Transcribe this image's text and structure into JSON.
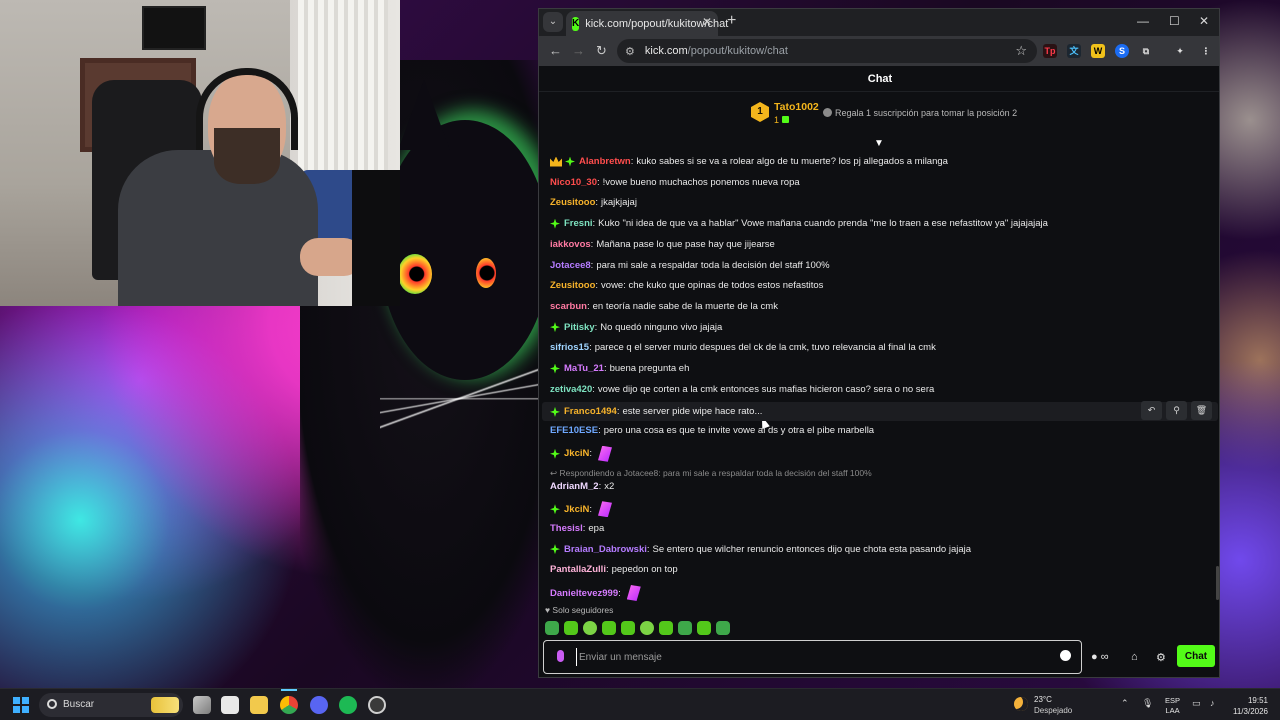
{
  "browser": {
    "tab_title": "kick.com/popout/kukitow/chat",
    "url_host": "kick.com",
    "url_path": "/popout/kukitow/chat"
  },
  "chat": {
    "header_title": "Chat",
    "leaderboard": {
      "rank": "1",
      "name": "Tato1002",
      "count": "1",
      "hint": "Regala 1 suscripción para tomar la posición 2"
    },
    "messages": [
      {
        "user": "Alanbretwn",
        "text": "kuko sabes si se va a rolear algo de tu muerte? los pj allegados a milanga",
        "color": "#ff4d4d",
        "badges": [
          "crown",
          "sub"
        ]
      },
      {
        "user": "Nico10_30",
        "text": "!vowe bueno muchachos ponemos nueva ropa",
        "color": "#ff4d4d",
        "badges": []
      },
      {
        "user": "Zeusitooo",
        "text": "jkajkjajaj",
        "color": "#f7b32b",
        "badges": []
      },
      {
        "user": "Fresni",
        "text": "Kuko \"ni idea de que va a hablar\" Vowe mañana cuando prenda \"me lo traen a ese nefastitow ya\" jajajajaja",
        "color": "#7ee3c1",
        "badges": [
          "sub"
        ]
      },
      {
        "user": "iakkovos",
        "text": "Mañana pase lo que pase hay que jijearse",
        "color": "#ff7aa2",
        "badges": []
      },
      {
        "user": "Jotacee8",
        "text": "para mi sale a respaldar toda la decisión del staff 100%",
        "color": "#b57cff",
        "badges": []
      },
      {
        "user": "Zeusitooo",
        "text": "vowe: che kuko que opinas de todos estos nefastitos",
        "color": "#f7b32b",
        "badges": []
      },
      {
        "user": "scarbun",
        "text": "en teoría nadie sabe de la muerte de la cmk",
        "color": "#ff7aa2",
        "badges": []
      },
      {
        "user": "Pitisky",
        "text": "No quedó ninguno vivo jajaja",
        "color": "#7ee3c1",
        "badges": [
          "sub"
        ]
      },
      {
        "user": "sifrios15",
        "text": "parece q el server murio despues del ck de la cmk, tuvo relevancia al final la cmk",
        "color": "#9fd4ff",
        "badges": []
      },
      {
        "user": "MaTu_21",
        "text": "buena pregunta eh",
        "color": "#d67bff",
        "badges": [
          "sub"
        ]
      },
      {
        "user": "zetiva420",
        "text": "vowe dijo qe corten a la cmk entonces sus mafias hicieron caso? sera o no sera",
        "color": "#7ee3c1",
        "badges": []
      },
      {
        "user": "Franco1494",
        "text": "este server pide wipe hace rato...",
        "color": "#f7b32b",
        "badges": [
          "sub"
        ],
        "highlighted": true
      },
      {
        "user": "EFE10ESE",
        "text": "pero una cosa es que te invite vowe al ds y otra el pibe marbella",
        "color": "#6fa8ff",
        "badges": []
      },
      {
        "user": "JkciN",
        "text": "",
        "color": "#f7b32b",
        "badges": [
          "sub"
        ],
        "emote": true
      },
      {
        "user": "AdrianM_2",
        "text": "x2",
        "color": "#f0d9ff",
        "badges": [],
        "reply": "Respondiendo a Jotacee8: para mi sale a respaldar toda la decisión del staff 100%"
      },
      {
        "user": "JkciN",
        "text": "",
        "color": "#f7b32b",
        "badges": [
          "sub"
        ],
        "emote": true
      },
      {
        "user": "Thesisl",
        "text": "epa",
        "color": "#d67bff",
        "badges": []
      },
      {
        "user": "Braian_Dabrowski",
        "text": "Se entero que wilcher renuncio entonces dijo que chota esta pasando jajaja",
        "color": "#b57cff",
        "badges": [
          "sub"
        ]
      },
      {
        "user": "PantallaZulli",
        "text": "pepedon on top",
        "color": "#ffb3d9",
        "badges": []
      },
      {
        "user": "Danieltevez999",
        "text": "",
        "color": "#d67bff",
        "badges": [],
        "emote": true
      }
    ],
    "followers_only": "Solo seguidores",
    "input_placeholder": "Enviar un mensaje",
    "send_label": "Chat"
  },
  "taskbar": {
    "search_label": "Buscar",
    "weather_temp": "23°C",
    "weather_desc": "Despejado",
    "lang_top": "ESP",
    "lang_bottom": "LAA",
    "time": "19:51",
    "date": "11/3/2026"
  },
  "colors": {
    "kick_green": "#53fc18",
    "gold": "#f3b51c"
  }
}
